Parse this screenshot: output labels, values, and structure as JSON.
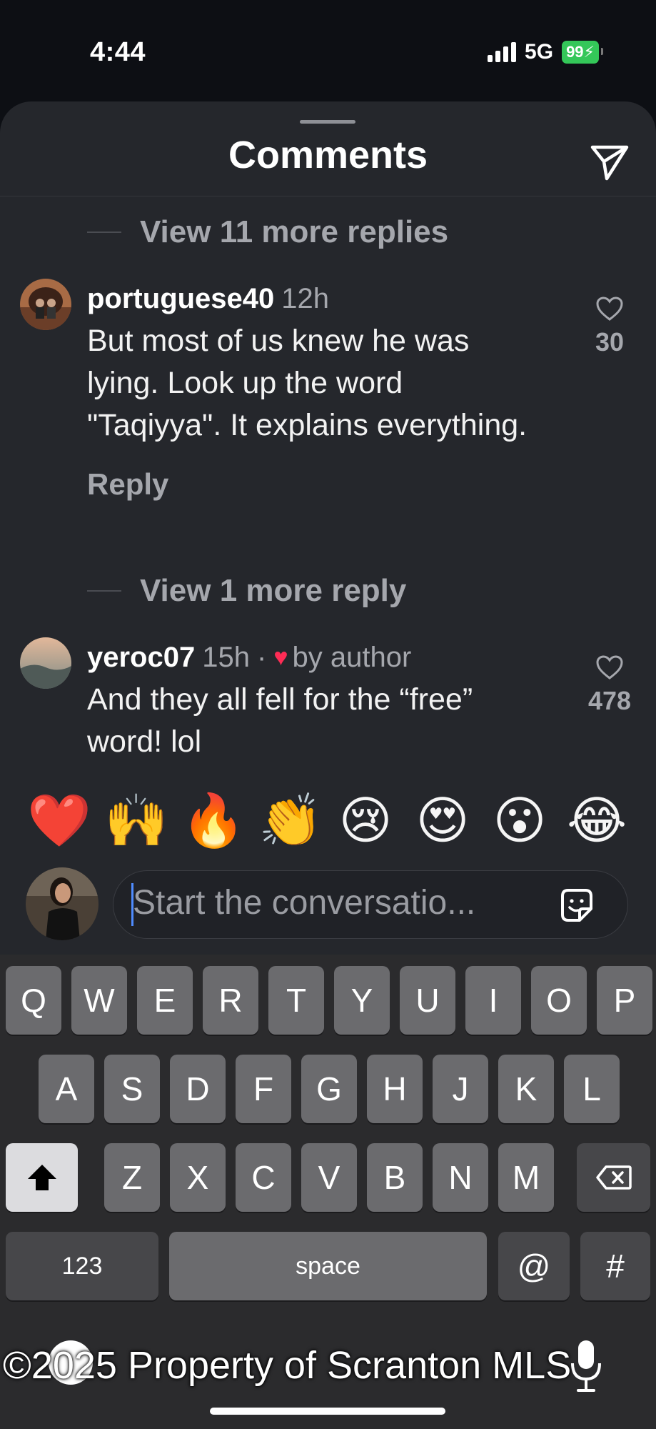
{
  "status": {
    "time": "4:44",
    "network": "5G",
    "battery": "99"
  },
  "header": {
    "title": "Comments"
  },
  "thread": {
    "view_more_1": "View 11 more replies",
    "view_more_2": "View 1 more reply",
    "comments": [
      {
        "username": "portuguese40",
        "time": "12h",
        "text": "But most of us knew he was lying. Look up the word \"Taqiyya\". It explains everything.",
        "likes": "30",
        "reply_label": "Reply"
      },
      {
        "username": "yeroc07",
        "time": "15h",
        "separator": "·",
        "liked_badge": "by author",
        "text": "And they all fell for the “free” word! lol",
        "likes": "478"
      }
    ]
  },
  "reactions": [
    "❤️",
    "🙌",
    "🔥",
    "👏",
    "😢",
    "😍",
    "😮",
    "😂"
  ],
  "composer": {
    "placeholder": "Start the conversatio..."
  },
  "keyboard": {
    "row1": [
      "Q",
      "W",
      "E",
      "R",
      "T",
      "Y",
      "U",
      "I",
      "O",
      "P"
    ],
    "row2": [
      "A",
      "S",
      "D",
      "F",
      "G",
      "H",
      "J",
      "K",
      "L"
    ],
    "row3": [
      "Z",
      "X",
      "C",
      "V",
      "B",
      "N",
      "M"
    ],
    "numbers_label": "123",
    "space_label": "space",
    "at_label": "@",
    "hash_label": "#"
  },
  "watermark": "©2025 Property of Scranton MLS",
  "colors": {
    "accent_like": "#fe2c55",
    "battery": "#34c759",
    "sheet": "#25272c"
  }
}
